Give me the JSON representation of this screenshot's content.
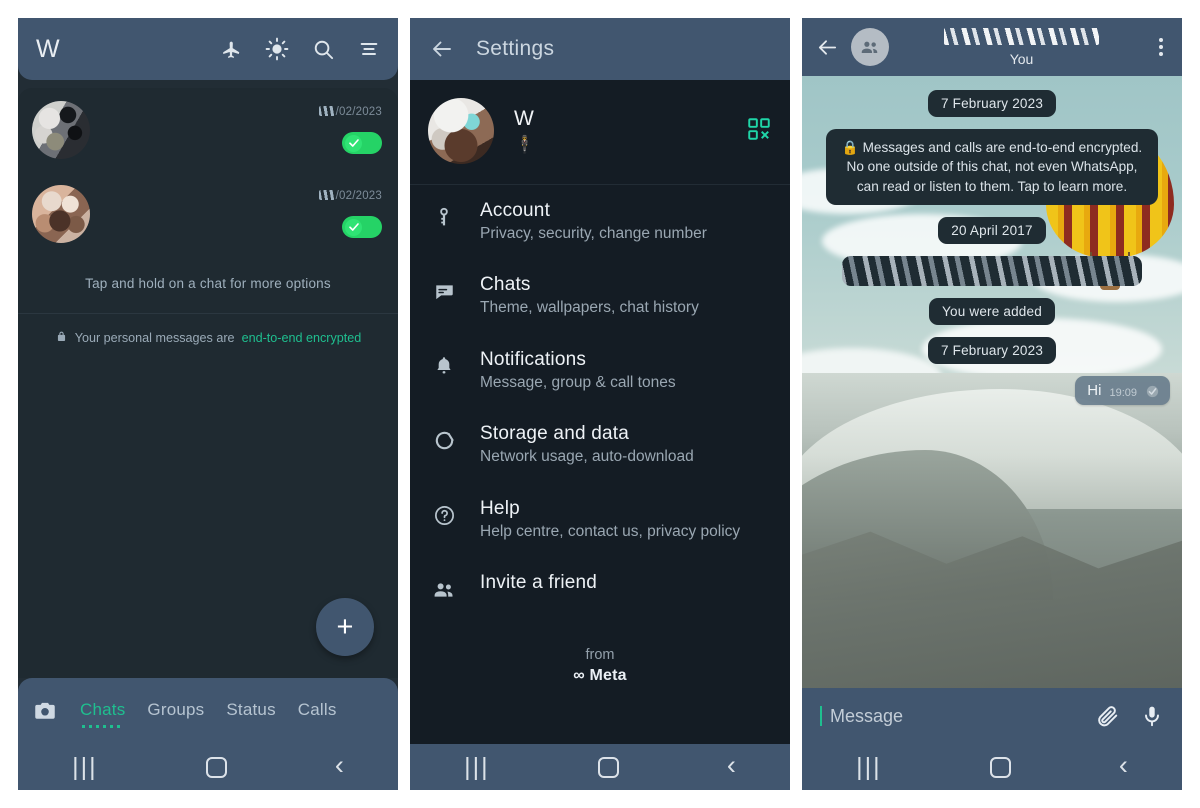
{
  "colors": {
    "header": "#41566f",
    "accent_teal": "#1fbf8f",
    "unread_green": "#25d366",
    "qr_teal": "#1fd6a8",
    "list_bg": "#1f2a31",
    "settings_bg": "#141c24"
  },
  "chatlist": {
    "logo": "W",
    "actions": [
      {
        "name": "airplane-mode-icon",
        "label": "airplane-mode-icon"
      },
      {
        "name": "brightness-icon",
        "label": "brightness-icon"
      },
      {
        "name": "search-icon",
        "label": "search-icon"
      },
      {
        "name": "menu-icon",
        "label": "menu-icon"
      }
    ],
    "rows": [
      {
        "date": "/02/2023",
        "badge": "read-check",
        "name_redacted": true,
        "preview_redacted": true
      },
      {
        "date": "/02/2023",
        "badge": "read-check",
        "name_redacted": true,
        "preview_redacted": true
      }
    ],
    "hint": "Tap and hold on a chat for more options",
    "e2e_prefix": "Your personal messages are",
    "e2e_link": "end-to-end encrypted",
    "fab": "+",
    "camera_icon": "camera-icon",
    "tabs": [
      {
        "label": "Chats",
        "active": true
      },
      {
        "label": "Groups",
        "active": false
      },
      {
        "label": "Status",
        "active": false
      },
      {
        "label": "Calls",
        "active": false
      }
    ]
  },
  "settings": {
    "title": "Settings",
    "back_icon": "back-arrow-icon",
    "profile": {
      "name": "W",
      "status": "🕴",
      "qr_icon": "qr-code-icon"
    },
    "items": [
      {
        "icon": "key-icon",
        "title": "Account",
        "sub": "Privacy, security, change number"
      },
      {
        "icon": "chat-icon",
        "title": "Chats",
        "sub": "Theme, wallpapers, chat history"
      },
      {
        "icon": "bell-icon",
        "title": "Notifications",
        "sub": "Message, group & call tones"
      },
      {
        "icon": "storage-icon",
        "title": "Storage and data",
        "sub": "Network usage, auto-download"
      },
      {
        "icon": "help-icon",
        "title": "Help",
        "sub": "Help centre, contact us, privacy policy"
      },
      {
        "icon": "people-icon",
        "title": "Invite a friend",
        "sub": ""
      }
    ],
    "from_label": "from",
    "from_brand": "∞ Meta"
  },
  "conversation": {
    "back_icon": "back-arrow-icon",
    "group_avatar_icon": "group-avatar-icon",
    "title_redacted": true,
    "subtitle": "You",
    "overflow_icon": "more-vert-icon",
    "messages": [
      {
        "type": "date",
        "text": "7 February 2023"
      },
      {
        "type": "notice",
        "text": "Messages and calls are end-to-end encrypted. No one outside of this chat, not even WhatsApp, can read or listen to them. Tap to learn more."
      },
      {
        "type": "date",
        "text": "20 April 2017"
      },
      {
        "type": "redacted"
      },
      {
        "type": "system",
        "text": "You were added"
      },
      {
        "type": "date",
        "text": "7 February 2023"
      },
      {
        "type": "outgoing",
        "text": "Hi",
        "time": "19:09",
        "status": "read"
      }
    ],
    "composer": {
      "placeholder": "Message",
      "attach_icon": "paperclip-icon",
      "mic_icon": "microphone-icon"
    }
  },
  "navbar": {
    "recents": "recents-icon",
    "home": "home-icon",
    "back": "back-icon"
  }
}
